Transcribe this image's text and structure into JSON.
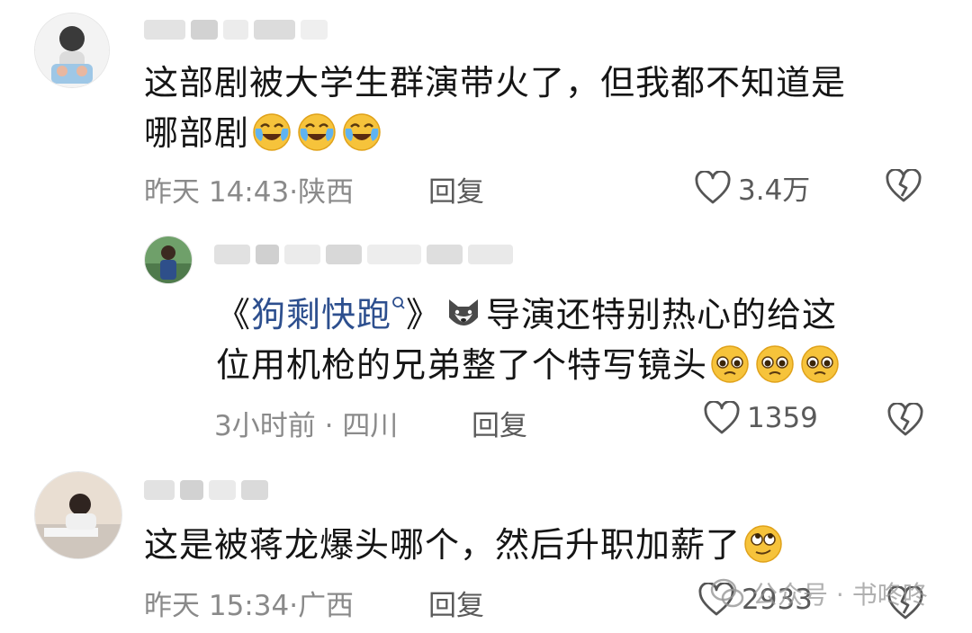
{
  "comments": [
    {
      "text_line1": "这部剧被大学生群演带火了，但我都不知道是",
      "text_line2": "哪部剧",
      "time": "昨天 14:43",
      "region": "陕西",
      "reply_label": "回复",
      "likes": "3.4万",
      "emoji": "laughing-crying-emoji"
    },
    {
      "title_prefix": "《",
      "title_link": "狗剩快跑",
      "title_suffix": "》",
      "text_line1_rest": "导演还特别热心的给这",
      "text_line2": "位用机枪的兄弟整了个特写镜头",
      "time": "3小时前",
      "region": "四川",
      "reply_label": "回复",
      "likes": "1359",
      "emoji": "pleading-face-emoji"
    },
    {
      "text_line1": "这是被蒋龙爆头哪个，然后升职加薪了",
      "time": "昨天 15:34",
      "region": "广西",
      "reply_label": "回复",
      "likes": "2933",
      "emoji": "rolling-eyes-emoji"
    }
  ],
  "watermark": {
    "text": "公众号 · 书咚咚"
  },
  "colors": {
    "link": "#2d4f8e",
    "meta": "#8a8a8a",
    "text": "#151515"
  }
}
